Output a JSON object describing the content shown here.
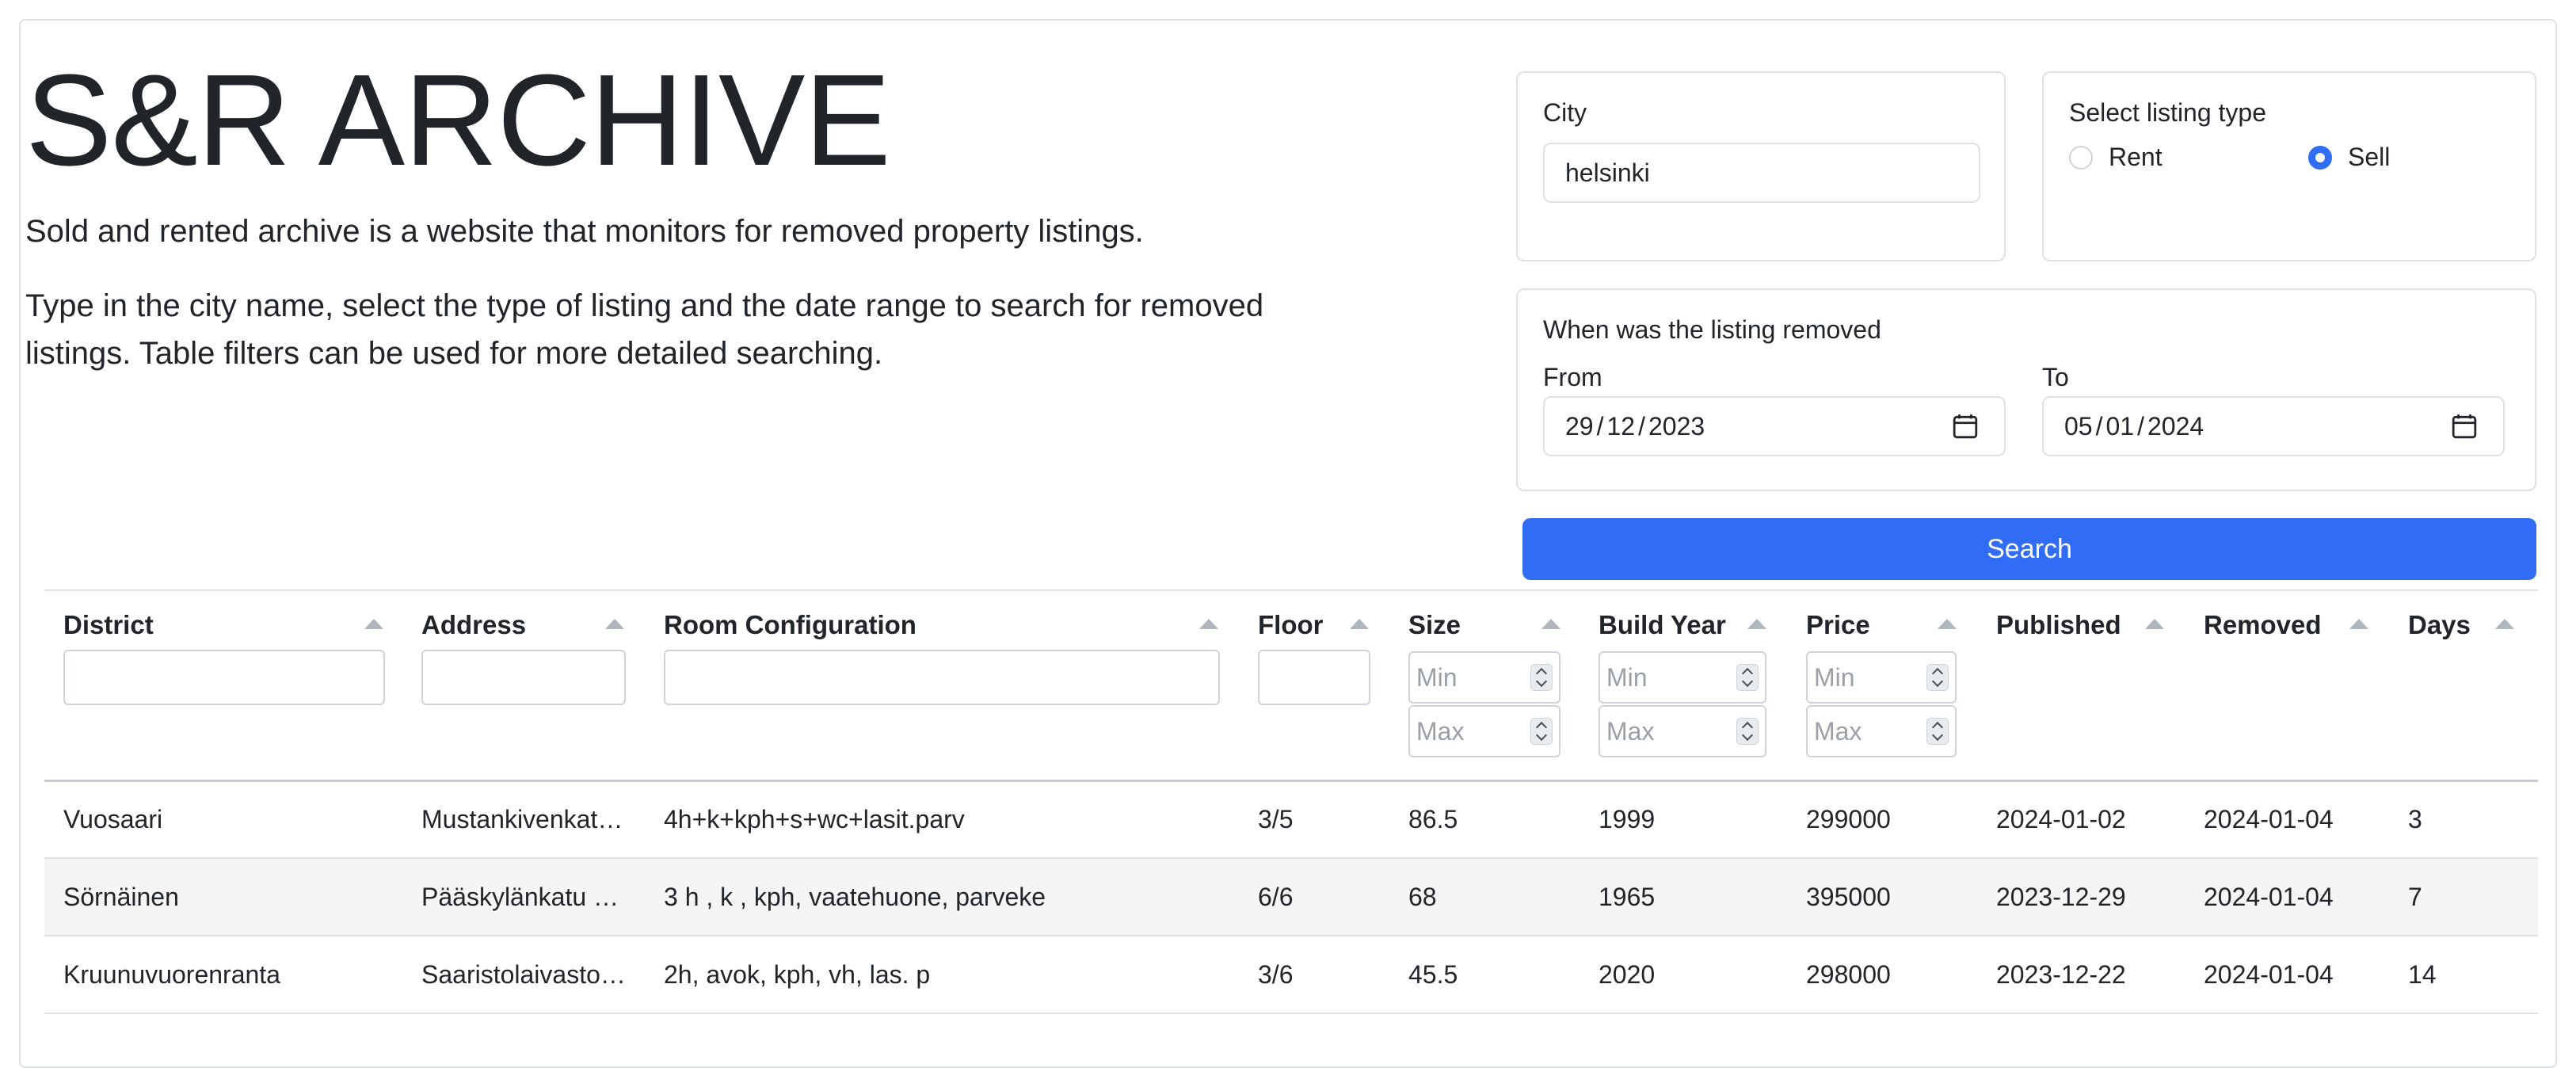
{
  "header": {
    "title": "S&R ARCHIVE",
    "intro_1": "Sold and rented archive is a website that monitors for removed property listings.",
    "intro_2": "Type in the city name, select the type of listing and the date range to search for removed listings. Table filters can be used for more detailed searching."
  },
  "city_card": {
    "label": "City",
    "value": "helsinki"
  },
  "listing_type_card": {
    "label": "Select listing type",
    "options": [
      {
        "label": "Rent",
        "checked": false
      },
      {
        "label": "Sell",
        "checked": true
      }
    ]
  },
  "date_card": {
    "label": "When was the listing removed",
    "from_label": "From",
    "from_value": {
      "d": "29",
      "m": "12",
      "y": "2023"
    },
    "to_label": "To",
    "to_value": {
      "d": "05",
      "m": "01",
      "y": "2024"
    }
  },
  "search_button": {
    "label": "Search"
  },
  "table": {
    "columns": [
      {
        "label": "District",
        "filter": "text"
      },
      {
        "label": "Address",
        "filter": "text"
      },
      {
        "label": "Room Configuration",
        "filter": "text"
      },
      {
        "label": "Floor",
        "filter": "text"
      },
      {
        "label": "Size",
        "filter": "range"
      },
      {
        "label": "Build Year",
        "filter": "range"
      },
      {
        "label": "Price",
        "filter": "range"
      },
      {
        "label": "Published",
        "filter": "none"
      },
      {
        "label": "Removed",
        "filter": "none"
      },
      {
        "label": "Days",
        "filter": "none"
      }
    ],
    "min_placeholder": "Min",
    "max_placeholder": "Max",
    "rows": [
      [
        "Vuosaari",
        "Mustankivenkat…",
        "4h+k+kph+s+wc+lasit.parv",
        "3/5",
        "86.5",
        "1999",
        "299000",
        "2024-01-02",
        "2024-01-04",
        "3"
      ],
      [
        "Sörnäinen",
        "Pääskylänkatu …",
        "3 h , k , kph, vaatehuone, parveke",
        "6/6",
        "68",
        "1965",
        "395000",
        "2023-12-29",
        "2024-01-04",
        "7"
      ],
      [
        "Kruunuvuorenranta",
        "Saaristolaivasto…",
        "2h, avok, kph, vh, las. p",
        "3/6",
        "45.5",
        "2020",
        "298000",
        "2023-12-22",
        "2024-01-04",
        "14"
      ]
    ]
  },
  "colors": {
    "accent": "#316cf4",
    "border": "#dee2e6",
    "stripe": "#f5f5f5"
  }
}
